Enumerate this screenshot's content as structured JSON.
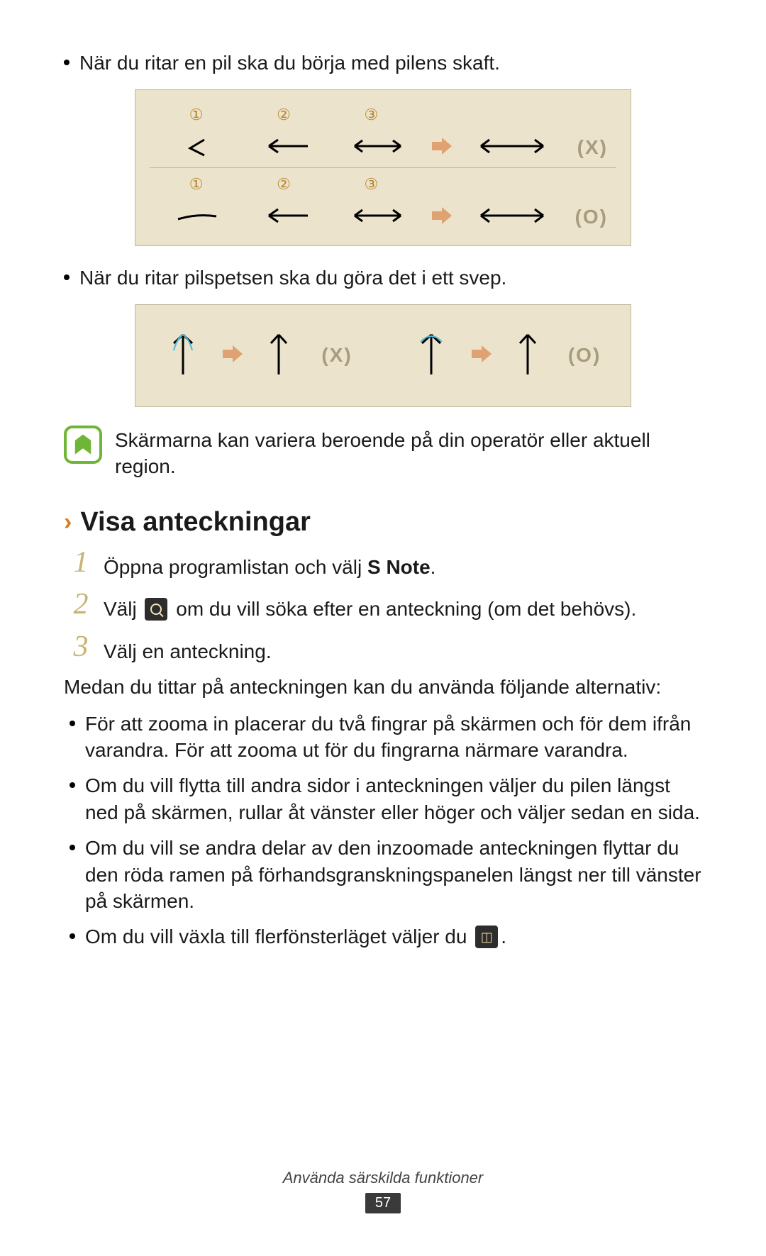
{
  "bullets_top": [
    "När du ritar en pil ska du börja med pilens skaft.",
    "När du ritar pilspetsen ska du göra det i ett svep."
  ],
  "diagram1": {
    "nums": [
      "①",
      "②",
      "③"
    ],
    "labels": {
      "x": "(X)",
      "o": "(O)"
    }
  },
  "diagram2": {
    "labels": {
      "x": "(X)",
      "o": "(O)"
    }
  },
  "info_text": "Skärmarna kan variera beroende på din operatör eller aktuell region.",
  "section_title": "Visa anteckningar",
  "steps": {
    "s1_pre": "Öppna programlistan och välj ",
    "s1_bold": "S Note",
    "s1_post": ".",
    "s2_pre": "Välj ",
    "s2_post": " om du vill söka efter en anteckning (om det behövs).",
    "s3": "Välj en anteckning."
  },
  "mid_para": "Medan du tittar på anteckningen kan du använda följande alternativ:",
  "bullets_bottom": [
    "För att zooma in placerar du två fingrar på skärmen och för dem ifrån varandra. För att zooma ut för du fingrarna närmare varandra.",
    "Om du vill flytta till andra sidor i anteckningen väljer du pilen längst ned på skärmen, rullar åt vänster eller höger och väljer sedan en sida.",
    "Om du vill se andra delar av den inzoomade anteckningen flyttar du den röda ramen på förhandsgranskningspanelen längst ner till vänster på skärmen."
  ],
  "bullet_multi_pre": "Om du vill växla till flerfönsterläget väljer du ",
  "bullet_multi_post": ".",
  "footer": "Använda särskilda funktioner",
  "page": "57"
}
